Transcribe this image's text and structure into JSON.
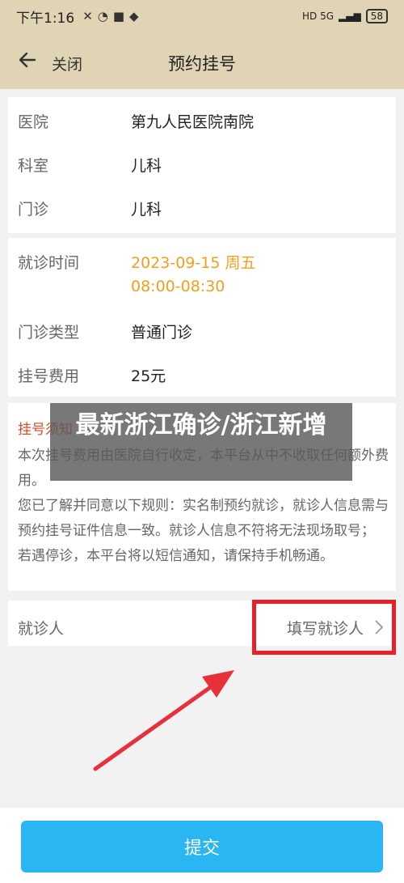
{
  "status_bar": {
    "time": "下午1:16",
    "battery": "58",
    "network": "HD 5G"
  },
  "nav": {
    "close_label": "关闭",
    "title": "预约挂号"
  },
  "info": {
    "hospital_label": "医院",
    "hospital_value": "第九人民医院南院",
    "department_label": "科室",
    "department_value": "儿科",
    "clinic_label": "门诊",
    "clinic_value": "儿科"
  },
  "visit": {
    "time_label": "就诊时间",
    "date_value": "2023-09-15  周五",
    "time_value": "08:00-08:30",
    "type_label": "门诊类型",
    "type_value": "普通门诊",
    "fee_label": "挂号费用",
    "fee_value": "25元"
  },
  "notice": {
    "title": "挂号须知",
    "text": "本次挂号费用由医院自行收定，本平台从中不收取任何额外费用。\n您已了解并同意以下规则：实名制预约就诊，就诊人信息需与预约挂号证件信息一致。就诊人信息不符将无法现场取号；\n若遇停诊，本平台将以短信通知，请保持手机畅通。"
  },
  "patient": {
    "label": "就诊人",
    "link": "填写就诊人"
  },
  "watermark": "最新浙江确诊/浙江新增",
  "submit_label": "提交",
  "colors": {
    "header_bg": "#e0d4b5",
    "accent_orange": "#f0a020",
    "submit_blue": "#29b6f2",
    "notice_red": "#d84a2a",
    "highlight_red": "#e8202a"
  }
}
